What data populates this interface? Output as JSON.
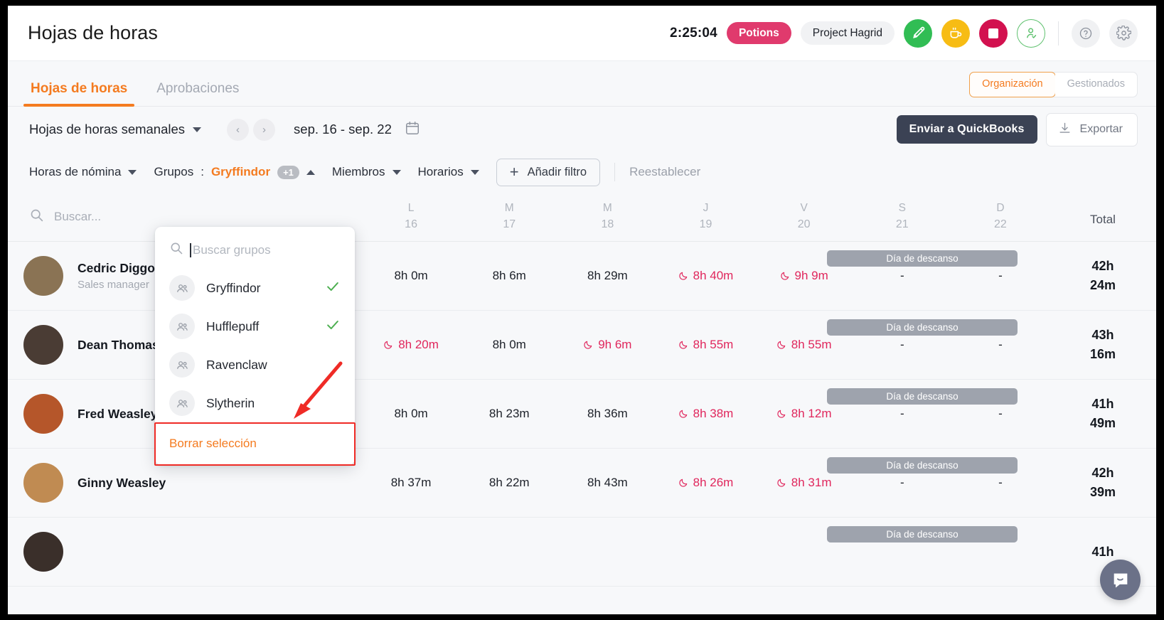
{
  "header": {
    "title": "Hojas de horas",
    "timer": "2:25:04",
    "task_pill": "Potions",
    "project_pill": "Project Hagrid",
    "icons": [
      "activity-icon",
      "coffee-break-icon",
      "stop-timer-icon",
      "user-check-icon",
      "help-icon",
      "settings-icon"
    ]
  },
  "tabs": [
    {
      "label": "Hojas de horas",
      "active": true
    },
    {
      "label": "Aprobaciones",
      "active": false
    }
  ],
  "scope_toggle": {
    "selected": "Organización",
    "options": [
      "Organización",
      "Gestionados"
    ]
  },
  "controls": {
    "view_select": "Hojas de horas semanales",
    "date_range": "sep. 16 - sep. 22",
    "prev_label": "‹",
    "next_label": "›",
    "quickbooks_button": "Enviar a QuickBooks",
    "export_button": "Exportar"
  },
  "filters": {
    "payroll_hours": "Horas de nómina",
    "groups_label": "Grupos",
    "groups_value": "Gryffindor",
    "groups_extra": "+1",
    "members": "Miembros",
    "schedules": "Horarios",
    "add_filter": "Añadir filtro",
    "reset": "Reestablecer"
  },
  "dropdown": {
    "search_placeholder": "Buscar grupos",
    "items": [
      {
        "label": "Gryffindor",
        "checked": true
      },
      {
        "label": "Hufflepuff",
        "checked": true
      },
      {
        "label": "Ravenclaw",
        "checked": false
      },
      {
        "label": "Slytherin",
        "checked": false
      }
    ],
    "clear_label": "Borrar selección"
  },
  "table": {
    "search_placeholder": "Buscar...",
    "total_header": "Total",
    "rest_day_label": "Día de descanso",
    "empty_cell": "-",
    "columns": [
      {
        "dow": "L",
        "day": "16"
      },
      {
        "dow": "M",
        "day": "17"
      },
      {
        "dow": "M",
        "day": "18"
      },
      {
        "dow": "J",
        "day": "19"
      },
      {
        "dow": "V",
        "day": "20"
      },
      {
        "dow": "S",
        "day": "21"
      },
      {
        "dow": "D",
        "day": "22"
      }
    ],
    "rows": [
      {
        "name": "Cedric Diggory",
        "role": "Sales manager",
        "avatar": "#8a7354",
        "cells": [
          {
            "value": "8h 0m",
            "overtime": false
          },
          {
            "value": "8h 6m",
            "overtime": false
          },
          {
            "value": "8h 29m",
            "overtime": false
          },
          {
            "value": "8h 40m",
            "overtime": true
          },
          {
            "value": "9h 9m",
            "overtime": true
          },
          {
            "value": "-",
            "overtime": false,
            "rest": true
          },
          {
            "value": "-",
            "overtime": false,
            "rest": true
          }
        ],
        "total_h": "42h",
        "total_m": "24m"
      },
      {
        "name": "Dean Thomas",
        "role": "",
        "avatar": "#4a3c34",
        "cells": [
          {
            "value": "",
            "overtime": false
          },
          {
            "value": "8h 20m",
            "overtime": true
          },
          {
            "value": "8h 0m",
            "overtime": false
          },
          {
            "value": "9h 6m",
            "overtime": true
          },
          {
            "value": "8h 55m",
            "overtime": true
          },
          {
            "value": "8h 55m",
            "overtime": true
          },
          {
            "value": "-",
            "overtime": false,
            "rest": true
          },
          {
            "value": "-",
            "overtime": false,
            "rest": true
          }
        ],
        "total_h": "43h",
        "total_m": "16m"
      },
      {
        "name": "Fred Weasley",
        "role": "",
        "avatar": "#b5562a",
        "cells": [
          {
            "value": "8h 0m",
            "overtime": false
          },
          {
            "value": "8h 23m",
            "overtime": false
          },
          {
            "value": "8h 36m",
            "overtime": false
          },
          {
            "value": "8h 38m",
            "overtime": true
          },
          {
            "value": "8h 12m",
            "overtime": true
          },
          {
            "value": "-",
            "overtime": false,
            "rest": true
          },
          {
            "value": "-",
            "overtime": false,
            "rest": true
          }
        ],
        "total_h": "41h",
        "total_m": "49m"
      },
      {
        "name": "Ginny Weasley",
        "role": "",
        "avatar": "#c08b52",
        "cells": [
          {
            "value": "8h 37m",
            "overtime": false
          },
          {
            "value": "8h 22m",
            "overtime": false
          },
          {
            "value": "8h 43m",
            "overtime": false
          },
          {
            "value": "8h 26m",
            "overtime": true
          },
          {
            "value": "8h 31m",
            "overtime": true
          },
          {
            "value": "-",
            "overtime": false,
            "rest": true
          },
          {
            "value": "-",
            "overtime": false,
            "rest": true
          }
        ],
        "total_h": "42h",
        "total_m": "39m"
      },
      {
        "name": "",
        "role": "",
        "avatar": "#3a2f2a",
        "cells": [
          {
            "value": "",
            "overtime": false
          },
          {
            "value": "",
            "overtime": false
          },
          {
            "value": "",
            "overtime": false
          },
          {
            "value": "",
            "overtime": false
          },
          {
            "value": "",
            "overtime": false
          },
          {
            "value": "",
            "overtime": false,
            "rest": true
          },
          {
            "value": "",
            "overtime": false,
            "rest": true
          }
        ],
        "total_h": "41h",
        "total_m": ""
      }
    ]
  },
  "colors": {
    "accent": "#f47b20",
    "overtime": "#e0265c",
    "dark_button": "#3b4254",
    "annotation": "#ef2b26",
    "rest_band": "#9ea3ad"
  },
  "chat_widget": {
    "icon": "chat-bubble-icon"
  }
}
